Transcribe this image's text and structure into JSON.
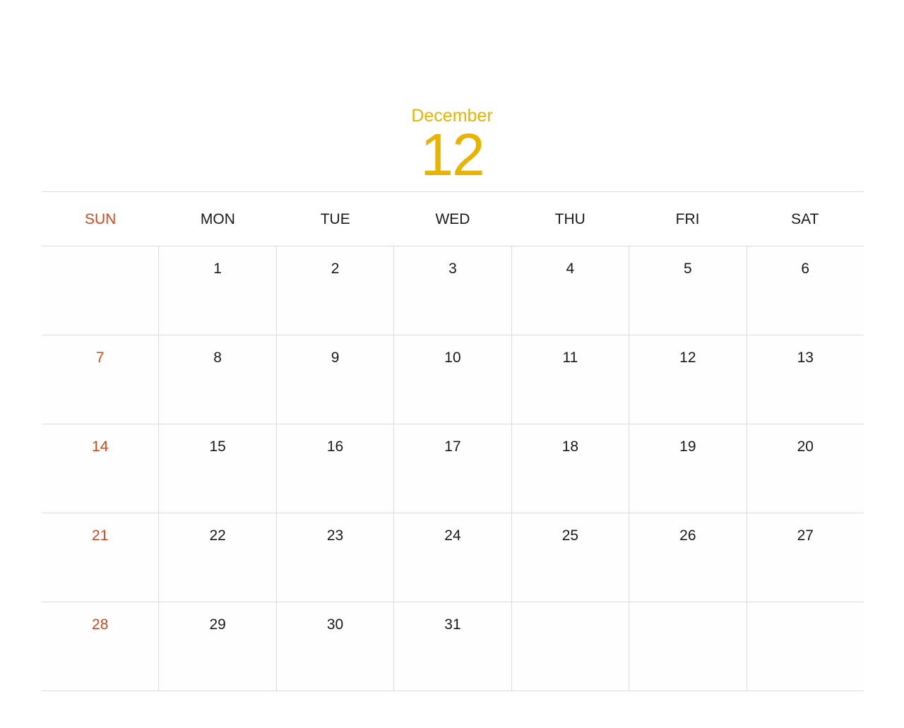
{
  "header": {
    "month_name": "December",
    "month_number": "12"
  },
  "colors": {
    "accent": "#e8b400",
    "sunday": "#d9471a",
    "text": "#1a1a1a",
    "grid": "#dcdcdc"
  },
  "weekdays": [
    "SUN",
    "MON",
    "TUE",
    "WED",
    "THU",
    "FRI",
    "SAT"
  ],
  "weeks": [
    [
      "",
      "1",
      "2",
      "3",
      "4",
      "5",
      "6"
    ],
    [
      "7",
      "8",
      "9",
      "10",
      "11",
      "12",
      "13"
    ],
    [
      "14",
      "15",
      "16",
      "17",
      "18",
      "19",
      "20"
    ],
    [
      "21",
      "22",
      "23",
      "24",
      "25",
      "26",
      "27"
    ],
    [
      "28",
      "29",
      "30",
      "31",
      "",
      "",
      ""
    ]
  ]
}
